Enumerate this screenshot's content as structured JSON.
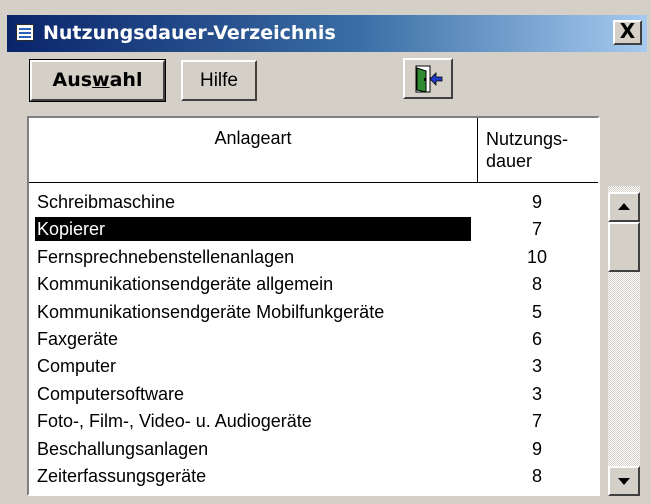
{
  "window": {
    "title": "Nutzungsdauer-Verzeichnis",
    "close_label": "X",
    "app_icon": "list-window-icon"
  },
  "toolbar": {
    "auswahl_pre": "Aus",
    "auswahl_underline": "w",
    "auswahl_post": "ahl",
    "hilfe_label": "Hilfe",
    "exit_icon": "exit-door-icon"
  },
  "table": {
    "header_anlageart": "Anlageart",
    "header_nutzungsdauer_line1": "Nutzungs-",
    "header_nutzungsdauer_line2": "dauer",
    "selected_index": 1,
    "rows": [
      {
        "anlageart": "Schreibmaschine",
        "dauer": "9"
      },
      {
        "anlageart": "Kopierer",
        "dauer": "7"
      },
      {
        "anlageart": "Fernsprechnebenstellenanlagen",
        "dauer": "10"
      },
      {
        "anlageart": "Kommunikationsendgeräte allgemein",
        "dauer": "8"
      },
      {
        "anlageart": "Kommunikationsendgeräte Mobilfunkgeräte",
        "dauer": "5"
      },
      {
        "anlageart": "Faxgeräte",
        "dauer": "6"
      },
      {
        "anlageart": "Computer",
        "dauer": "3"
      },
      {
        "anlageart": "Computersoftware",
        "dauer": "3"
      },
      {
        "anlageart": "Foto-, Film-, Video- u. Audiogeräte",
        "dauer": "7"
      },
      {
        "anlageart": "Beschallungsanlagen",
        "dauer": "9"
      },
      {
        "anlageart": "Zeiterfassungsgeräte",
        "dauer": "8"
      }
    ]
  },
  "scrollbar": {
    "up_icon": "scroll-up-arrow-icon",
    "down_icon": "scroll-down-arrow-icon"
  },
  "colors": {
    "titlebar_start": "#0a246a",
    "titlebar_end": "#a6caf0",
    "selection_bg": "#000000",
    "face": "#d4d0c8"
  }
}
